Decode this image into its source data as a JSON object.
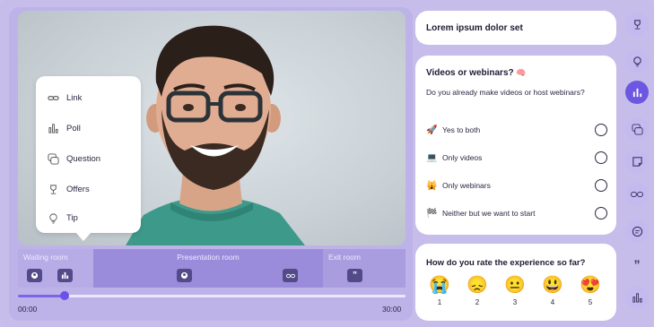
{
  "menu": {
    "items": [
      {
        "label": "Link",
        "icon": "link-icon"
      },
      {
        "label": "Poll",
        "icon": "poll-icon"
      },
      {
        "label": "Question",
        "icon": "question-icon"
      },
      {
        "label": "Offers",
        "icon": "trophy-icon"
      },
      {
        "label": "Tip",
        "icon": "lightbulb-icon"
      }
    ]
  },
  "timeline": {
    "rooms": {
      "waiting": "Waiting room",
      "presentation": "Presentation room",
      "exit": "Exit room"
    },
    "time_start": "00:00",
    "time_end": "30:00",
    "progress": 0.12
  },
  "cards": {
    "header_title": "Lorem ipsum dolor set",
    "poll": {
      "title": "Videos or webinars?",
      "title_emoji": "🧠",
      "question": "Do you already make videos or host webinars?",
      "options": [
        {
          "emoji": "🚀",
          "label": "Yes to both"
        },
        {
          "emoji": "💻",
          "label": "Only videos"
        },
        {
          "emoji": "🙀",
          "label": "Only webinars"
        },
        {
          "emoji": "🏁",
          "label": "Neither but we want to start"
        }
      ]
    },
    "rating": {
      "title": "How do you rate the experience so far?",
      "options": [
        {
          "emoji": "😭",
          "num": "1"
        },
        {
          "emoji": "😞",
          "num": "2"
        },
        {
          "emoji": "😐",
          "num": "3"
        },
        {
          "emoji": "😃",
          "num": "4"
        },
        {
          "emoji": "😍",
          "num": "5"
        }
      ]
    }
  },
  "rail": {
    "icons": [
      "trophy-icon",
      "lightbulb-icon",
      "poll-icon",
      "question-icon",
      "note-icon",
      "link-icon",
      "chat-icon",
      "quote-icon",
      "poll-icon"
    ],
    "active_index": 2
  },
  "colors": {
    "background": "#c6bdea",
    "accent": "#6c57e2",
    "card": "#ffffff",
    "chip": "#534a8a"
  }
}
